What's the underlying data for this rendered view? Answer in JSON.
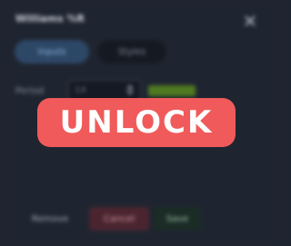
{
  "dialog": {
    "title": "Williams %R",
    "tabs": [
      {
        "label": "Inputs",
        "active": true
      },
      {
        "label": "Styles",
        "active": false
      }
    ],
    "field": {
      "label": "Period",
      "value": "14"
    },
    "buttons": {
      "remove": "Remove",
      "cancel": "Cancel",
      "save": "Save"
    }
  },
  "overlay": {
    "unlock_label": "UNLOCK"
  },
  "colors": {
    "background": "#1f2530",
    "unlock": "#f05a5a",
    "tab_active": "#2d4766",
    "accent": "#4f7a21"
  },
  "icons": [
    "close-icon",
    "stepper-icon"
  ]
}
